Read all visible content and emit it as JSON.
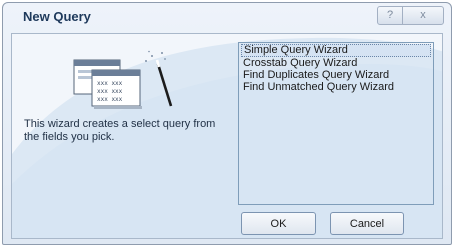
{
  "dialog": {
    "title": "New Query",
    "help_glyph": "?",
    "close_glyph": "x"
  },
  "description": "This wizard creates a select query from the fields you pick.",
  "wizards": [
    {
      "label": "Simple Query Wizard",
      "selected": true
    },
    {
      "label": "Crosstab Query Wizard",
      "selected": false
    },
    {
      "label": "Find Duplicates Query Wizard",
      "selected": false
    },
    {
      "label": "Find Unmatched Query Wizard",
      "selected": false
    }
  ],
  "buttons": {
    "ok": "OK",
    "cancel": "Cancel"
  },
  "icons": {
    "wizard_image": "wizard-illustration-icon",
    "help": "help-icon",
    "close": "close-icon"
  },
  "colors": {
    "title": "#1e395b",
    "background": "#eef3fa",
    "swoosh": "#dce8f4",
    "selection": "#d5e3f3"
  }
}
